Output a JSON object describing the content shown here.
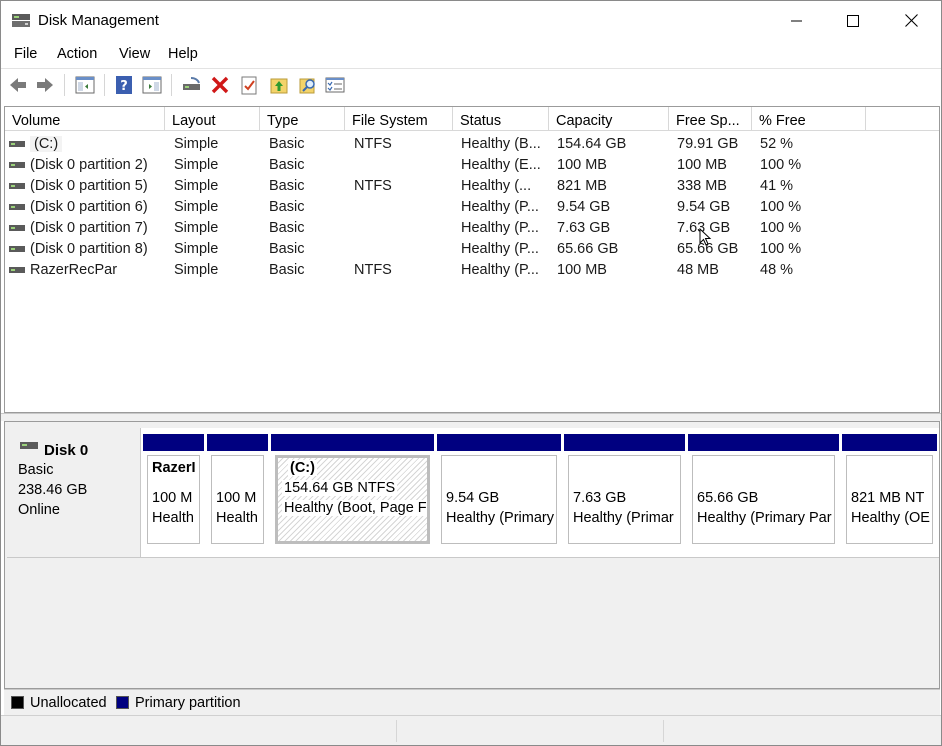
{
  "window": {
    "title": "Disk Management"
  },
  "menu": [
    "File",
    "Action",
    "View",
    "Help"
  ],
  "toolbar": {
    "icons": [
      "back-icon",
      "forward-icon",
      "show-hide-console-tree-icon",
      "help-icon",
      "show-hide-action-pane-icon",
      "connect-drive-icon",
      "delete-icon",
      "properties-icon",
      "up-folder-icon",
      "search-icon",
      "list-view-icon"
    ]
  },
  "volumes": {
    "columns": [
      "Volume",
      "Layout",
      "Type",
      "File System",
      "Status",
      "Capacity",
      "Free Sp...",
      "% Free"
    ],
    "rows": [
      [
        "(C:)",
        "Simple",
        "Basic",
        "NTFS",
        "Healthy (B...",
        "154.64 GB",
        "79.91 GB",
        "52 %"
      ],
      [
        "(Disk 0 partition 2)",
        "Simple",
        "Basic",
        "",
        "Healthy (E...",
        "100 MB",
        "100 MB",
        "100 %"
      ],
      [
        "(Disk 0 partition 5)",
        "Simple",
        "Basic",
        "NTFS",
        "Healthy (...",
        "821 MB",
        "338 MB",
        "41 %"
      ],
      [
        "(Disk 0 partition 6)",
        "Simple",
        "Basic",
        "",
        "Healthy (P...",
        "9.54 GB",
        "9.54 GB",
        "100 %"
      ],
      [
        "(Disk 0 partition 7)",
        "Simple",
        "Basic",
        "",
        "Healthy (P...",
        "7.63 GB",
        "7.63 GB",
        "100 %"
      ],
      [
        "(Disk 0 partition 8)",
        "Simple",
        "Basic",
        "",
        "Healthy (P...",
        "65.66 GB",
        "65.66 GB",
        "100 %"
      ],
      [
        "RazerRecPar",
        "Simple",
        "Basic",
        "NTFS",
        "Healthy (P...",
        "100 MB",
        "48 MB",
        "48 %"
      ]
    ]
  },
  "disk": {
    "name": "Disk 0",
    "type": "Basic",
    "size": "238.46 GB",
    "status": "Online",
    "partitions": [
      {
        "label": "RazerI",
        "size": "100 M",
        "status": "Health"
      },
      {
        "label": "",
        "size": "100 M",
        "status": "Health"
      },
      {
        "label": "(C:)",
        "size": "154.64 GB NTFS",
        "status": "Healthy (Boot, Page Fi"
      },
      {
        "label": "",
        "size": "9.54 GB",
        "status": "Healthy (Primary"
      },
      {
        "label": "",
        "size": "7.63 GB",
        "status": "Healthy (Primar"
      },
      {
        "label": "",
        "size": "65.66 GB",
        "status": "Healthy (Primary Par"
      },
      {
        "label": "",
        "size": "821 MB NT",
        "status": "Healthy (OE"
      }
    ]
  },
  "legend": [
    {
      "label": "Unallocated",
      "color": "#000000"
    },
    {
      "label": "Primary partition",
      "color": "#000080"
    }
  ],
  "colors": {
    "primary_partition_bar": "#000080",
    "unallocated": "#000000"
  }
}
